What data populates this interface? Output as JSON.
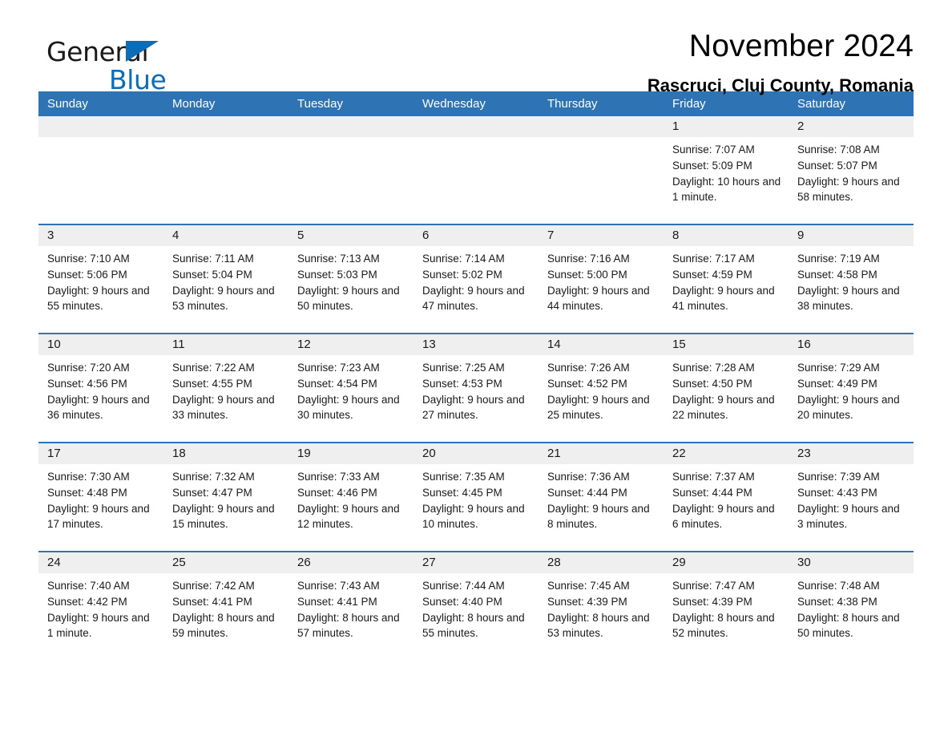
{
  "brand": {
    "name_part1": "General",
    "name_part2": "Blue",
    "accent_color": "#0b6cb7"
  },
  "header": {
    "title": "November 2024",
    "location": "Rascruci, Cluj County, Romania"
  },
  "theme": {
    "header_blue": "#2e74b5",
    "daynum_band": "#efefef",
    "text": "#1a1a1a"
  },
  "calendar": {
    "weekday_headers": [
      "Sunday",
      "Monday",
      "Tuesday",
      "Wednesday",
      "Thursday",
      "Friday",
      "Saturday"
    ],
    "labels": {
      "sunrise_prefix": "Sunrise: ",
      "sunset_prefix": "Sunset: ",
      "daylight_prefix": "Daylight: "
    },
    "weeks": [
      [
        {
          "day": "",
          "empty": true
        },
        {
          "day": "",
          "empty": true
        },
        {
          "day": "",
          "empty": true
        },
        {
          "day": "",
          "empty": true
        },
        {
          "day": "",
          "empty": true
        },
        {
          "day": "1",
          "sunrise": "Sunrise: 7:07 AM",
          "sunset": "Sunset: 5:09 PM",
          "daylight": "Daylight: 10 hours and 1 minute."
        },
        {
          "day": "2",
          "sunrise": "Sunrise: 7:08 AM",
          "sunset": "Sunset: 5:07 PM",
          "daylight": "Daylight: 9 hours and 58 minutes."
        }
      ],
      [
        {
          "day": "3",
          "sunrise": "Sunrise: 7:10 AM",
          "sunset": "Sunset: 5:06 PM",
          "daylight": "Daylight: 9 hours and 55 minutes."
        },
        {
          "day": "4",
          "sunrise": "Sunrise: 7:11 AM",
          "sunset": "Sunset: 5:04 PM",
          "daylight": "Daylight: 9 hours and 53 minutes."
        },
        {
          "day": "5",
          "sunrise": "Sunrise: 7:13 AM",
          "sunset": "Sunset: 5:03 PM",
          "daylight": "Daylight: 9 hours and 50 minutes."
        },
        {
          "day": "6",
          "sunrise": "Sunrise: 7:14 AM",
          "sunset": "Sunset: 5:02 PM",
          "daylight": "Daylight: 9 hours and 47 minutes."
        },
        {
          "day": "7",
          "sunrise": "Sunrise: 7:16 AM",
          "sunset": "Sunset: 5:00 PM",
          "daylight": "Daylight: 9 hours and 44 minutes."
        },
        {
          "day": "8",
          "sunrise": "Sunrise: 7:17 AM",
          "sunset": "Sunset: 4:59 PM",
          "daylight": "Daylight: 9 hours and 41 minutes."
        },
        {
          "day": "9",
          "sunrise": "Sunrise: 7:19 AM",
          "sunset": "Sunset: 4:58 PM",
          "daylight": "Daylight: 9 hours and 38 minutes."
        }
      ],
      [
        {
          "day": "10",
          "sunrise": "Sunrise: 7:20 AM",
          "sunset": "Sunset: 4:56 PM",
          "daylight": "Daylight: 9 hours and 36 minutes."
        },
        {
          "day": "11",
          "sunrise": "Sunrise: 7:22 AM",
          "sunset": "Sunset: 4:55 PM",
          "daylight": "Daylight: 9 hours and 33 minutes."
        },
        {
          "day": "12",
          "sunrise": "Sunrise: 7:23 AM",
          "sunset": "Sunset: 4:54 PM",
          "daylight": "Daylight: 9 hours and 30 minutes."
        },
        {
          "day": "13",
          "sunrise": "Sunrise: 7:25 AM",
          "sunset": "Sunset: 4:53 PM",
          "daylight": "Daylight: 9 hours and 27 minutes."
        },
        {
          "day": "14",
          "sunrise": "Sunrise: 7:26 AM",
          "sunset": "Sunset: 4:52 PM",
          "daylight": "Daylight: 9 hours and 25 minutes."
        },
        {
          "day": "15",
          "sunrise": "Sunrise: 7:28 AM",
          "sunset": "Sunset: 4:50 PM",
          "daylight": "Daylight: 9 hours and 22 minutes."
        },
        {
          "day": "16",
          "sunrise": "Sunrise: 7:29 AM",
          "sunset": "Sunset: 4:49 PM",
          "daylight": "Daylight: 9 hours and 20 minutes."
        }
      ],
      [
        {
          "day": "17",
          "sunrise": "Sunrise: 7:30 AM",
          "sunset": "Sunset: 4:48 PM",
          "daylight": "Daylight: 9 hours and 17 minutes."
        },
        {
          "day": "18",
          "sunrise": "Sunrise: 7:32 AM",
          "sunset": "Sunset: 4:47 PM",
          "daylight": "Daylight: 9 hours and 15 minutes."
        },
        {
          "day": "19",
          "sunrise": "Sunrise: 7:33 AM",
          "sunset": "Sunset: 4:46 PM",
          "daylight": "Daylight: 9 hours and 12 minutes."
        },
        {
          "day": "20",
          "sunrise": "Sunrise: 7:35 AM",
          "sunset": "Sunset: 4:45 PM",
          "daylight": "Daylight: 9 hours and 10 minutes."
        },
        {
          "day": "21",
          "sunrise": "Sunrise: 7:36 AM",
          "sunset": "Sunset: 4:44 PM",
          "daylight": "Daylight: 9 hours and 8 minutes."
        },
        {
          "day": "22",
          "sunrise": "Sunrise: 7:37 AM",
          "sunset": "Sunset: 4:44 PM",
          "daylight": "Daylight: 9 hours and 6 minutes."
        },
        {
          "day": "23",
          "sunrise": "Sunrise: 7:39 AM",
          "sunset": "Sunset: 4:43 PM",
          "daylight": "Daylight: 9 hours and 3 minutes."
        }
      ],
      [
        {
          "day": "24",
          "sunrise": "Sunrise: 7:40 AM",
          "sunset": "Sunset: 4:42 PM",
          "daylight": "Daylight: 9 hours and 1 minute."
        },
        {
          "day": "25",
          "sunrise": "Sunrise: 7:42 AM",
          "sunset": "Sunset: 4:41 PM",
          "daylight": "Daylight: 8 hours and 59 minutes."
        },
        {
          "day": "26",
          "sunrise": "Sunrise: 7:43 AM",
          "sunset": "Sunset: 4:41 PM",
          "daylight": "Daylight: 8 hours and 57 minutes."
        },
        {
          "day": "27",
          "sunrise": "Sunrise: 7:44 AM",
          "sunset": "Sunset: 4:40 PM",
          "daylight": "Daylight: 8 hours and 55 minutes."
        },
        {
          "day": "28",
          "sunrise": "Sunrise: 7:45 AM",
          "sunset": "Sunset: 4:39 PM",
          "daylight": "Daylight: 8 hours and 53 minutes."
        },
        {
          "day": "29",
          "sunrise": "Sunrise: 7:47 AM",
          "sunset": "Sunset: 4:39 PM",
          "daylight": "Daylight: 8 hours and 52 minutes."
        },
        {
          "day": "30",
          "sunrise": "Sunrise: 7:48 AM",
          "sunset": "Sunset: 4:38 PM",
          "daylight": "Daylight: 8 hours and 50 minutes."
        }
      ]
    ]
  }
}
